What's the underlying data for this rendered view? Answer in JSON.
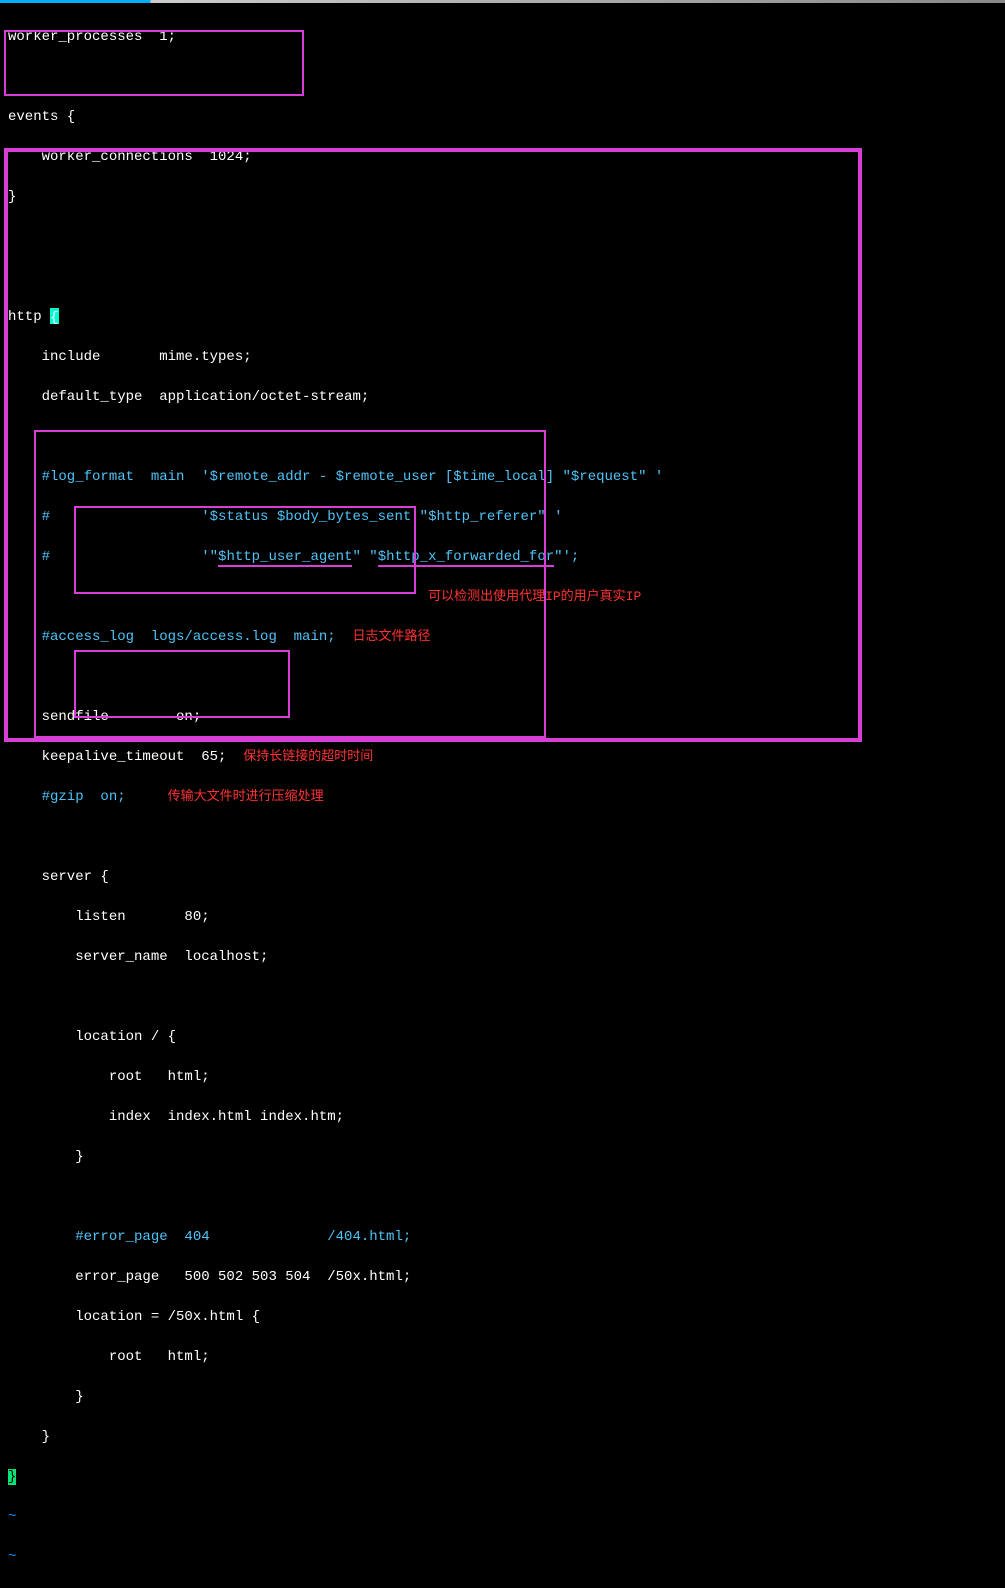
{
  "lines": {
    "l1": "worker_processes  1;",
    "l2": "",
    "l3": "events {",
    "l4": "    worker_connections  1024;",
    "l5": "}",
    "l6": "",
    "l7": "",
    "l8": "http ",
    "l8b": "{",
    "l9": "    include       mime.types;",
    "l10": "    default_type  application/octet-stream;",
    "l11": "",
    "l12": "    #log_format  main  '$remote_addr - $remote_user [$time_local] \"$request\" '",
    "l13": "    #                  '$status $body_bytes_sent \"$http_referer\" '",
    "l14a": "    #                  '\"",
    "l14u1": "$http_user_agent",
    "l14m": "\" \"",
    "l14u2": "$http_x_forwarded_for",
    "l14e": "\"';",
    "ann_proxy": "可以检测出使用代理IP的用户真实IP",
    "l15": "",
    "l16a": "    #access_log  logs/access.log  main;",
    "ann_log": "日志文件路径",
    "l17": "",
    "l18": "    sendfile        on;",
    "l19a": "    keepalive_timeout  65;",
    "ann_keep": "保持长链接的超时时间",
    "l20a": "    #gzip  on;",
    "ann_gzip": "传输大文件时进行压缩处理",
    "l21": "",
    "l22": "    server {",
    "l23": "        listen       80;",
    "l24": "        server_name  localhost;",
    "l25": "",
    "l26": "        location / {",
    "l27": "            root   html;",
    "l28": "            index  index.html index.htm;",
    "l29": "        }",
    "l30": "",
    "l31": "        #error_page  404              /404.html;",
    "l32": "        error_page   500 502 503 504  /50x.html;",
    "l33": "        location = /50x.html {",
    "l34": "            root   html;",
    "l35": "        }",
    "l36": "    }",
    "l37": "}",
    "tilde1": "~",
    "tilde2": "~"
  }
}
